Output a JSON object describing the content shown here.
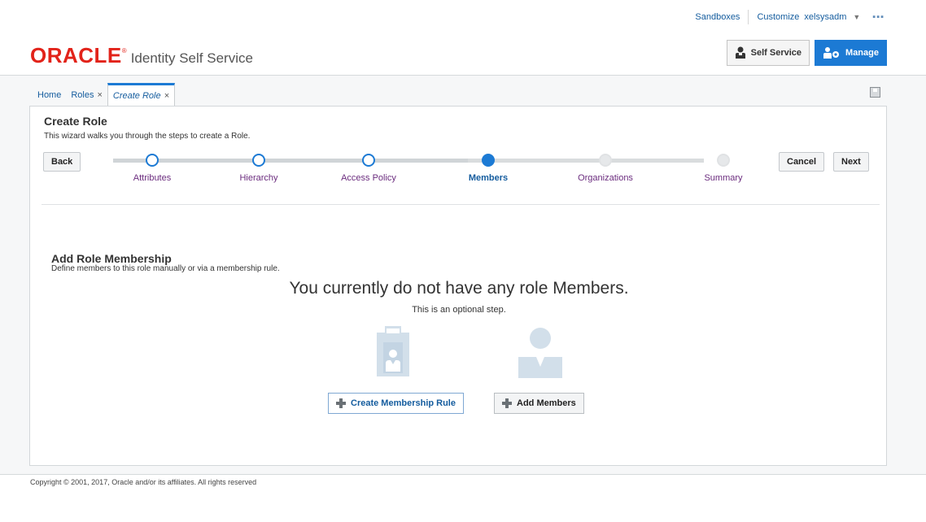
{
  "header": {
    "utility": {
      "sandboxes": "Sandboxes",
      "customize": "Customize",
      "username": "xelsysadm",
      "more": "▪▪▪"
    },
    "brand": {
      "logo": "ORACLE",
      "registered": "®",
      "product": "Identity Self Service"
    },
    "switcher": {
      "self_service": "Self Service",
      "manage": "Manage"
    }
  },
  "tabs": [
    {
      "label": "Home"
    },
    {
      "label": "Roles",
      "close": "×"
    },
    {
      "label": "Create Role",
      "close": "×"
    }
  ],
  "wizard": {
    "title": "Create Role",
    "subtitle": "This wizard walks you through the steps to create a Role.",
    "back_label": "Back",
    "cancel_label": "Cancel",
    "next_label": "Next",
    "steps": [
      {
        "label": "Attributes",
        "state": "visited"
      },
      {
        "label": "Hierarchy",
        "state": "visited"
      },
      {
        "label": "Access Policy",
        "state": "visited"
      },
      {
        "label": "Members",
        "state": "current"
      },
      {
        "label": "Organizations",
        "state": "future"
      },
      {
        "label": "Summary",
        "state": "future"
      }
    ]
  },
  "members": {
    "section_title": "Add Role Membership",
    "section_subtitle": "Define members to this role manually or via a membership rule.",
    "empty_message": "You currently do not have any role Members.",
    "optional_note": "This is an optional step.",
    "create_rule_label": "Create Membership Rule",
    "add_members_label": "Add Members"
  },
  "footer": {
    "copyright": "Copyright © 2001, 2017, Oracle and/or its affiliates. All rights reserved"
  },
  "colors": {
    "accent": "#1c7ad4",
    "oracle_red": "#e2231a",
    "link": "#145c9e",
    "train_label": "#6b2c7e"
  }
}
